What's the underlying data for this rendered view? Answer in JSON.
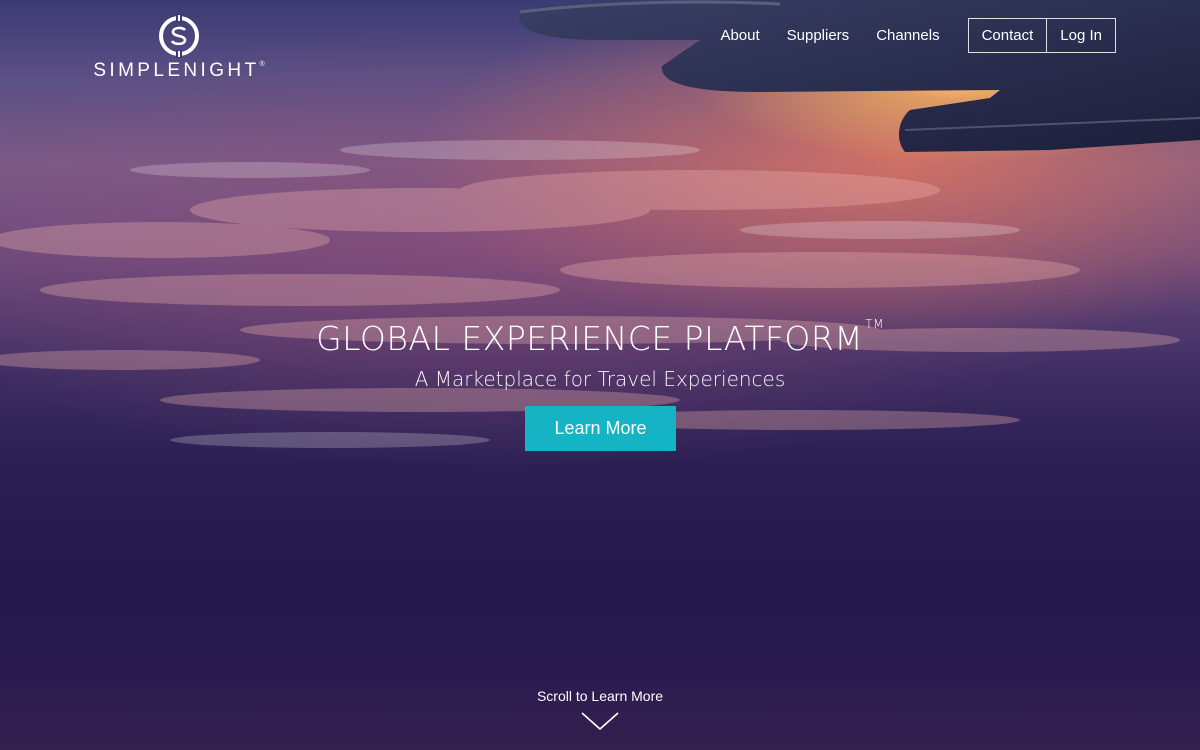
{
  "brand": {
    "name": "SIMPLENIGHT",
    "registered": "®",
    "logo_icon": "dollar-circle-icon"
  },
  "nav": {
    "links": [
      "About",
      "Suppliers",
      "Channels"
    ],
    "contact": "Contact",
    "login": "Log In"
  },
  "hero": {
    "title": "GLOBAL EXPERIENCE PLATFORM",
    "trademark": "TM",
    "subtitle": "A Marketplace for Travel Experiences",
    "cta": "Learn More",
    "scroll_text": "Scroll to Learn More",
    "scroll_icon": "chevron-down-icon"
  },
  "colors": {
    "accent": "#14b4c4",
    "sky_top": "#3b3b73",
    "sunset": "#f08a5a",
    "sky_bottom": "#241a4c"
  }
}
